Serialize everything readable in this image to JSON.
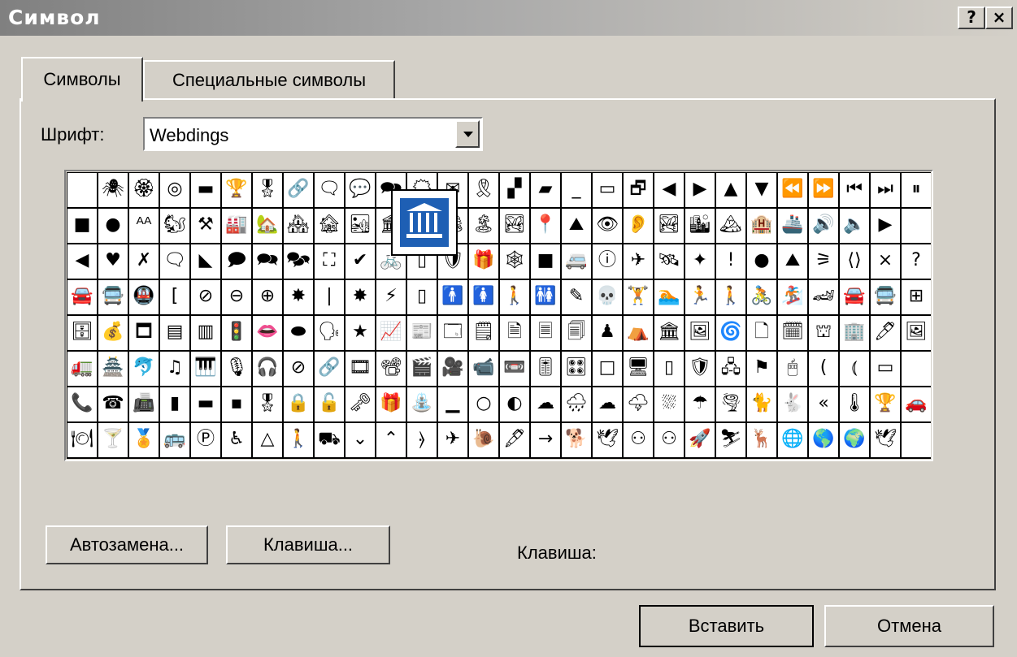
{
  "window": {
    "title": "Символ",
    "help_label": "?",
    "close_label": "×"
  },
  "tabs": [
    {
      "label": "Символы",
      "active": true
    },
    {
      "label": "Специальные символы",
      "active": false
    }
  ],
  "font": {
    "label": "Шрифт:",
    "value": "Webdings"
  },
  "symbol_grid": {
    "rows": [
      [
        "",
        "🕷",
        "🏵",
        "◎",
        "▬",
        "🏆",
        "🎖",
        "🔗",
        "🗨",
        "💬",
        "🗪",
        "🗯",
        "✉",
        "🎗",
        "▞",
        "▰",
        "_",
        "▭",
        "🗗",
        "◀",
        "▶",
        "▲",
        "▼",
        "⏪",
        "⏩",
        "⏮",
        "⏭",
        "⏸"
      ],
      [
        "■",
        "●",
        "ᴬᴬ",
        "🐿",
        "⚒",
        "🏭",
        "🏡",
        "🏘",
        "🏚",
        "🏜",
        "🏛",
        "🏟",
        "🏕",
        "🏝",
        "🏞",
        "📍",
        "⛰",
        "👁",
        "👂",
        "🏞",
        "🏙",
        "🏔",
        "🏨",
        "🚢",
        "🔊",
        "🔈",
        "▶",
        ""
      ],
      [
        "◀",
        "♥",
        "✗",
        "🗨",
        "◣",
        "🗩",
        "🗪",
        "🗫",
        "⛶",
        "✔",
        "🚲",
        "▯",
        "🛡",
        "🎁",
        "🕸",
        "■",
        "🚐",
        "ⓘ",
        "✈",
        "🛰",
        "✦",
        "!",
        "●",
        "⛰",
        "⚞",
        "⟨⟩",
        "×",
        "?"
      ],
      [
        "🚘",
        "🚍",
        "🚇",
        "[",
        "⊘",
        "⊖",
        "⊕",
        "✸",
        "|",
        "✸",
        "⚡",
        "▯",
        "🚹",
        "🚺",
        "🚶",
        "🚻",
        "✎",
        "💀",
        "🏋",
        "🏊",
        "🏃",
        "🚶",
        "🚴",
        "🏂",
        "🏎",
        "🚘",
        "🚍",
        "⊞"
      ],
      [
        "🗄",
        "💰",
        "🗖",
        "▤",
        "▥",
        "🚦",
        "👄",
        "⬬",
        "🗣",
        "★",
        "📈",
        "📰",
        "🗔",
        "🗒",
        "🗎",
        "🗏",
        "🗐",
        "♟",
        "⛺",
        "🏛",
        "🖼",
        "🌀",
        "🗋",
        "🗓",
        "⛫",
        "🏢",
        "🖊",
        "🖼"
      ],
      [
        "🚛",
        "🏯",
        "🐬",
        "♫",
        "🎹",
        "🎙",
        "🎧",
        "⊘",
        "🔗",
        "🎞",
        "📽",
        "🎬",
        "🎥",
        "📹",
        "📼",
        "🎚",
        "🎛",
        "□",
        "🖥",
        "▯",
        "🛡",
        "🖧",
        "⚑",
        "🖱",
        "(",
        "⦅",
        "▭",
        ""
      ],
      [
        "📞",
        "☎",
        "📠",
        "▮",
        "▬",
        "▪",
        "🎖",
        "🔒",
        "🔓",
        "🗝",
        "🎁",
        "⛲",
        "▁",
        "○",
        "◐",
        "☁",
        "🌧",
        "☁",
        "🌩",
        "⛆",
        "☂",
        "🌪",
        "🐈",
        "🐇",
        "«",
        "🌡",
        "🏆",
        "🚗"
      ],
      [
        "🍽",
        "🍸",
        "🏅",
        "🚌",
        "Ⓟ",
        "♿",
        "△",
        "🚶",
        "⛟",
        "⌄",
        "⌃",
        "⦒",
        "✈",
        "🐌",
        "🖋",
        "→",
        "🐕",
        "🕊",
        "⚇",
        "⚇",
        "🚀",
        "⛷",
        "🦌",
        "🌐",
        "🌎",
        "🌍",
        "🕊",
        ""
      ]
    ],
    "zoomed_symbol_icon": "classical-building-icon"
  },
  "buttons": {
    "autocorrect": "Автозамена...",
    "shortcut_key": "Клавиша...",
    "insert": "Вставить",
    "cancel": "Отмена"
  },
  "shortcut_label": "Клавиша:"
}
